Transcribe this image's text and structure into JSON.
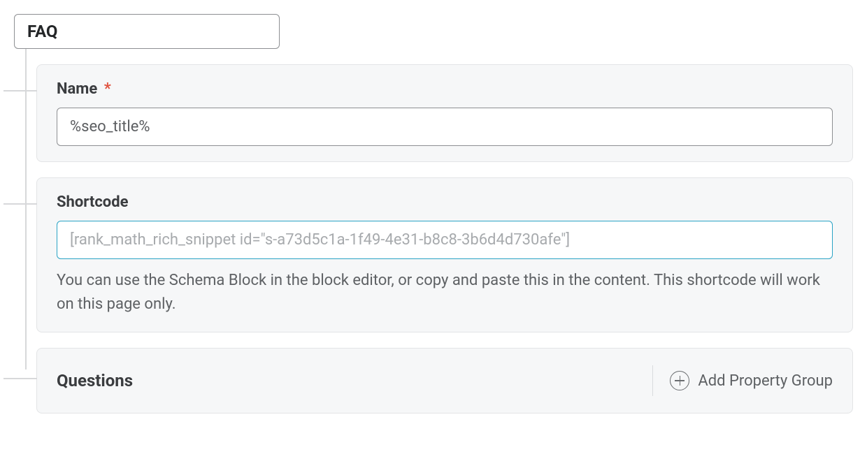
{
  "schema": {
    "type_label": "FAQ",
    "name": {
      "label": "Name",
      "required_marker": "*",
      "value": "%seo_title%"
    },
    "shortcode": {
      "label": "Shortcode",
      "value": "[rank_math_rich_snippet id=\"s-a73d5c1a-1f49-4e31-b8c8-3b6d4d730afe\"]",
      "help": "You can use the Schema Block in the block editor, or copy and paste this in the content. This shortcode will work on this page only."
    },
    "questions": {
      "label": "Questions",
      "add_button_label": "Add Property Group"
    }
  }
}
